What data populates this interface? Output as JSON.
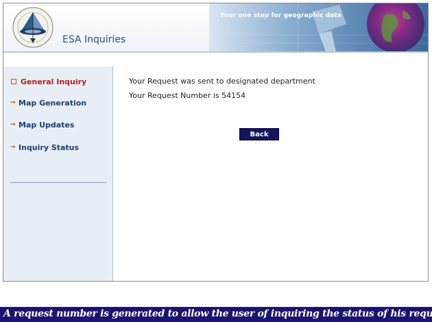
{
  "header": {
    "app_title": "ESA Inquiries",
    "tagline": "Your one stop for geographic data",
    "logo_icon": "egyptian-survey-authority-logo"
  },
  "sidebar": {
    "items": [
      {
        "label": "General Inquiry",
        "active": true,
        "icon": "square-bullet-icon"
      },
      {
        "label": "Map Generation",
        "active": false,
        "icon": "arrow-right-icon"
      },
      {
        "label": "Map Updates",
        "active": false,
        "icon": "arrow-right-icon"
      },
      {
        "label": "Inquiry Status",
        "active": false,
        "icon": "arrow-right-icon"
      }
    ]
  },
  "main": {
    "message": "Your Request was sent to designated department",
    "request_number_label": "Your Request Number is  54154",
    "back_label": "Back"
  },
  "caption": "A request number is generated to allow the user of inquiring the status of his request",
  "colors": {
    "caption_bg": "#1a1470",
    "button_bg": "#15155e",
    "active_nav": "#b52020",
    "nav": "#1a3e6e",
    "sidebar_bg": "#e8eef6"
  }
}
